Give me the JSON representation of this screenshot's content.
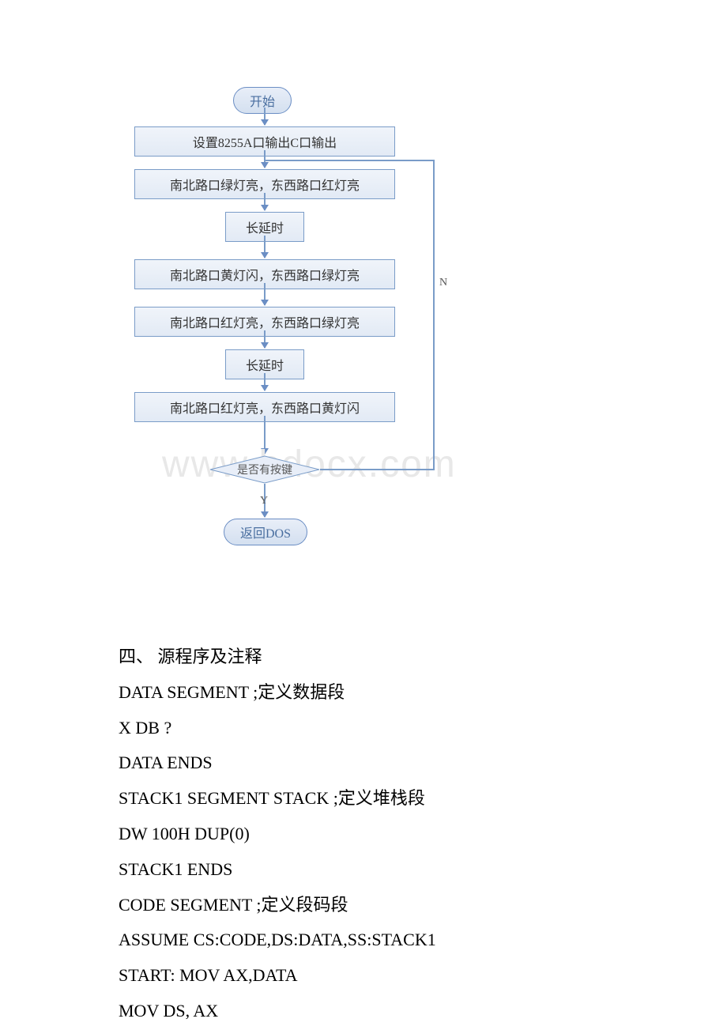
{
  "flowchart": {
    "start": "开始",
    "box1": "设置8255A口输出C口输出",
    "box2": "南北路口绿灯亮，东西路口红灯亮",
    "box3": "长延时",
    "box4": "南北路口黄灯闪，东西路口绿灯亮",
    "box5": "南北路口红灯亮，东西路口绿灯亮",
    "box6": "长延时",
    "box7": "南北路口红灯亮，东西路口黄灯闪",
    "decision": "是否有按键",
    "end": "返回DOS",
    "labelN": "N",
    "labelY": "Y"
  },
  "watermark": "www.bdocx.com",
  "code": {
    "heading": "四、 源程序及注释",
    "lines": [
      "DATA SEGMENT ;定义数据段",
      " X DB ?",
      "DATA ENDS",
      "STACK1 SEGMENT STACK ;定义堆栈段",
      " DW 100H DUP(0)",
      "STACK1 ENDS",
      "CODE SEGMENT ;定义段码段",
      "ASSUME CS:CODE,DS:DATA,SS:STACK1",
      "START: MOV AX,DATA",
      " MOV DS, AX"
    ]
  }
}
